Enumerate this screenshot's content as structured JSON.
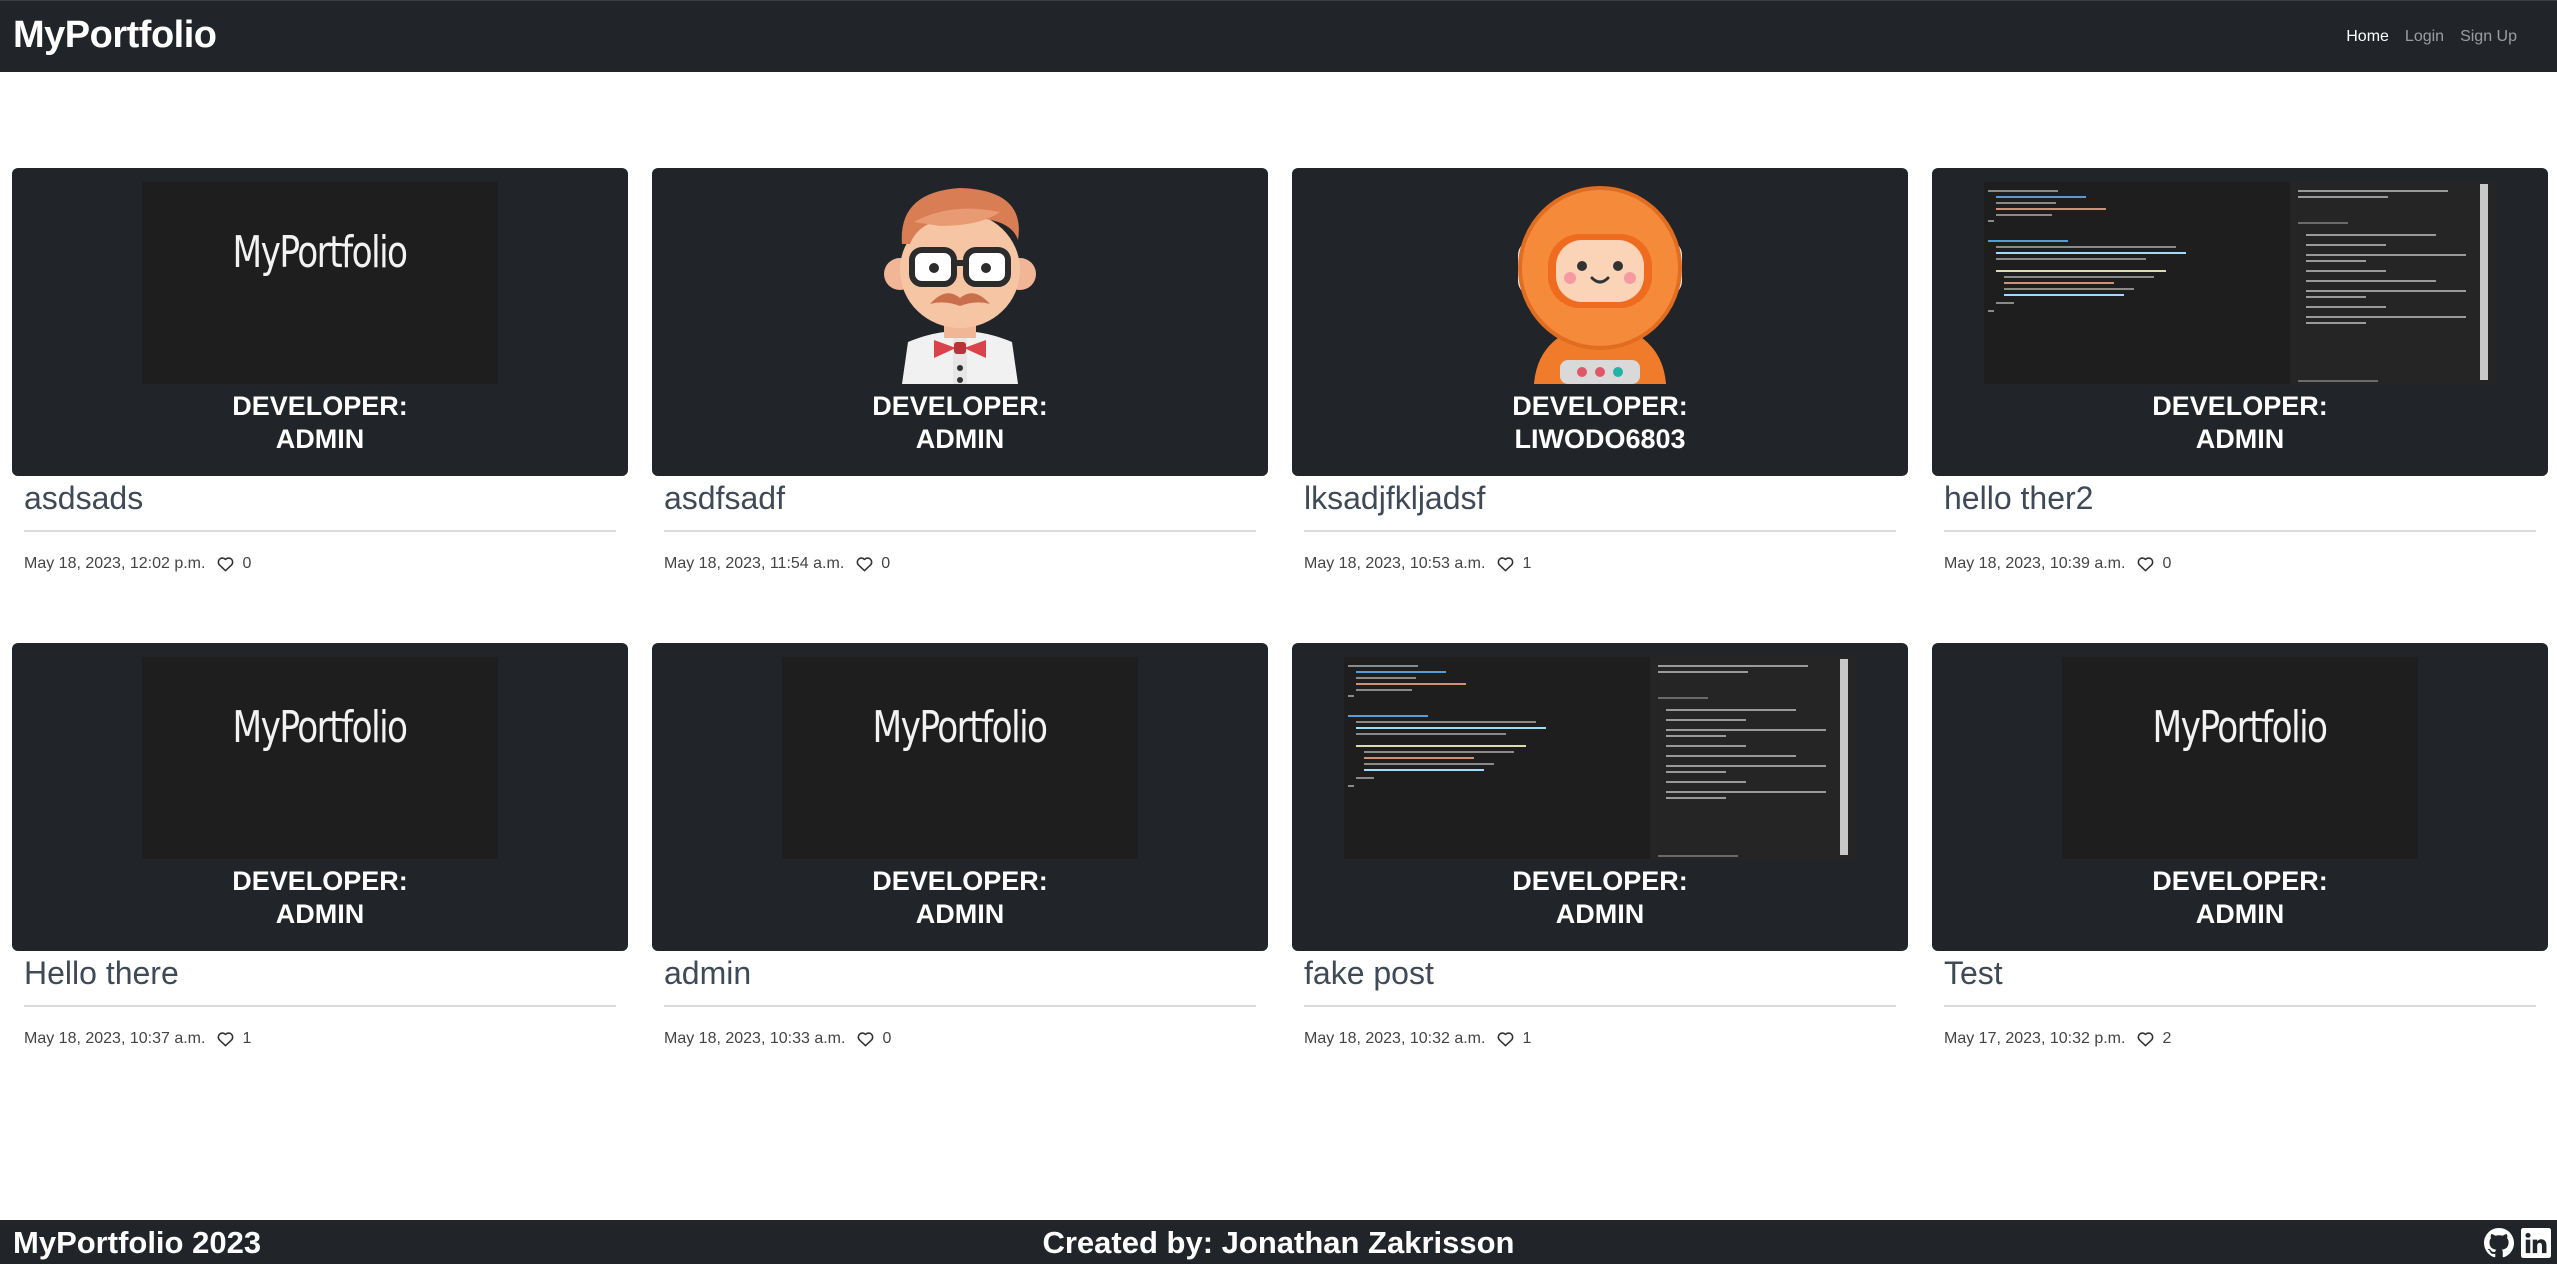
{
  "navbar": {
    "brand": "MyPortfolio",
    "links": [
      {
        "label": "Home"
      },
      {
        "label": "Login"
      },
      {
        "label": "Sign Up"
      }
    ]
  },
  "posts": [
    {
      "title": "asdsads",
      "developer_line1": "DEVELOPER:",
      "developer_line2": "ADMIN",
      "date": "May 18, 2023, 12:02 p.m.",
      "likes": "0",
      "thumb": "logo",
      "thumb_text": "MyPortfolio"
    },
    {
      "title": "asdfsadf",
      "developer_line1": "DEVELOPER:",
      "developer_line2": "ADMIN",
      "date": "May 18, 2023, 11:54 a.m.",
      "likes": "0",
      "thumb": "avatar-man"
    },
    {
      "title": "lksadjfkljadsf",
      "developer_line1": "DEVELOPER:",
      "developer_line2": "LIWODO6803",
      "date": "May 18, 2023, 10:53 a.m.",
      "likes": "1",
      "thumb": "avatar-astronaut"
    },
    {
      "title": "hello ther2",
      "developer_line1": "DEVELOPER:",
      "developer_line2": "ADMIN",
      "date": "May 18, 2023, 10:39 a.m.",
      "likes": "0",
      "thumb": "code-screenshot"
    },
    {
      "title": "Hello there",
      "developer_line1": "DEVELOPER:",
      "developer_line2": "ADMIN",
      "date": "May 18, 2023, 10:37 a.m.",
      "likes": "1",
      "thumb": "logo",
      "thumb_text": "MyPortfolio"
    },
    {
      "title": "admin",
      "developer_line1": "DEVELOPER:",
      "developer_line2": "ADMIN",
      "date": "May 18, 2023, 10:33 a.m.",
      "likes": "0",
      "thumb": "logo",
      "thumb_text": "MyPortfolio"
    },
    {
      "title": "fake post",
      "developer_line1": "DEVELOPER:",
      "developer_line2": "ADMIN",
      "date": "May 18, 2023, 10:32 a.m.",
      "likes": "1",
      "thumb": "code-screenshot"
    },
    {
      "title": "Test",
      "developer_line1": "DEVELOPER:",
      "developer_line2": "ADMIN",
      "date": "May 17, 2023, 10:32 p.m.",
      "likes": "2",
      "thumb": "logo",
      "thumb_text": "MyPortfolio"
    }
  ],
  "footer": {
    "left": "MyPortfolio 2023",
    "center": "Created by: Jonathan Zakrisson",
    "icons": [
      "github-icon",
      "linkedin-icon"
    ]
  },
  "colors": {
    "dark": "#212529",
    "title_text": "#3f4a56",
    "divider": "#d8dadc"
  }
}
